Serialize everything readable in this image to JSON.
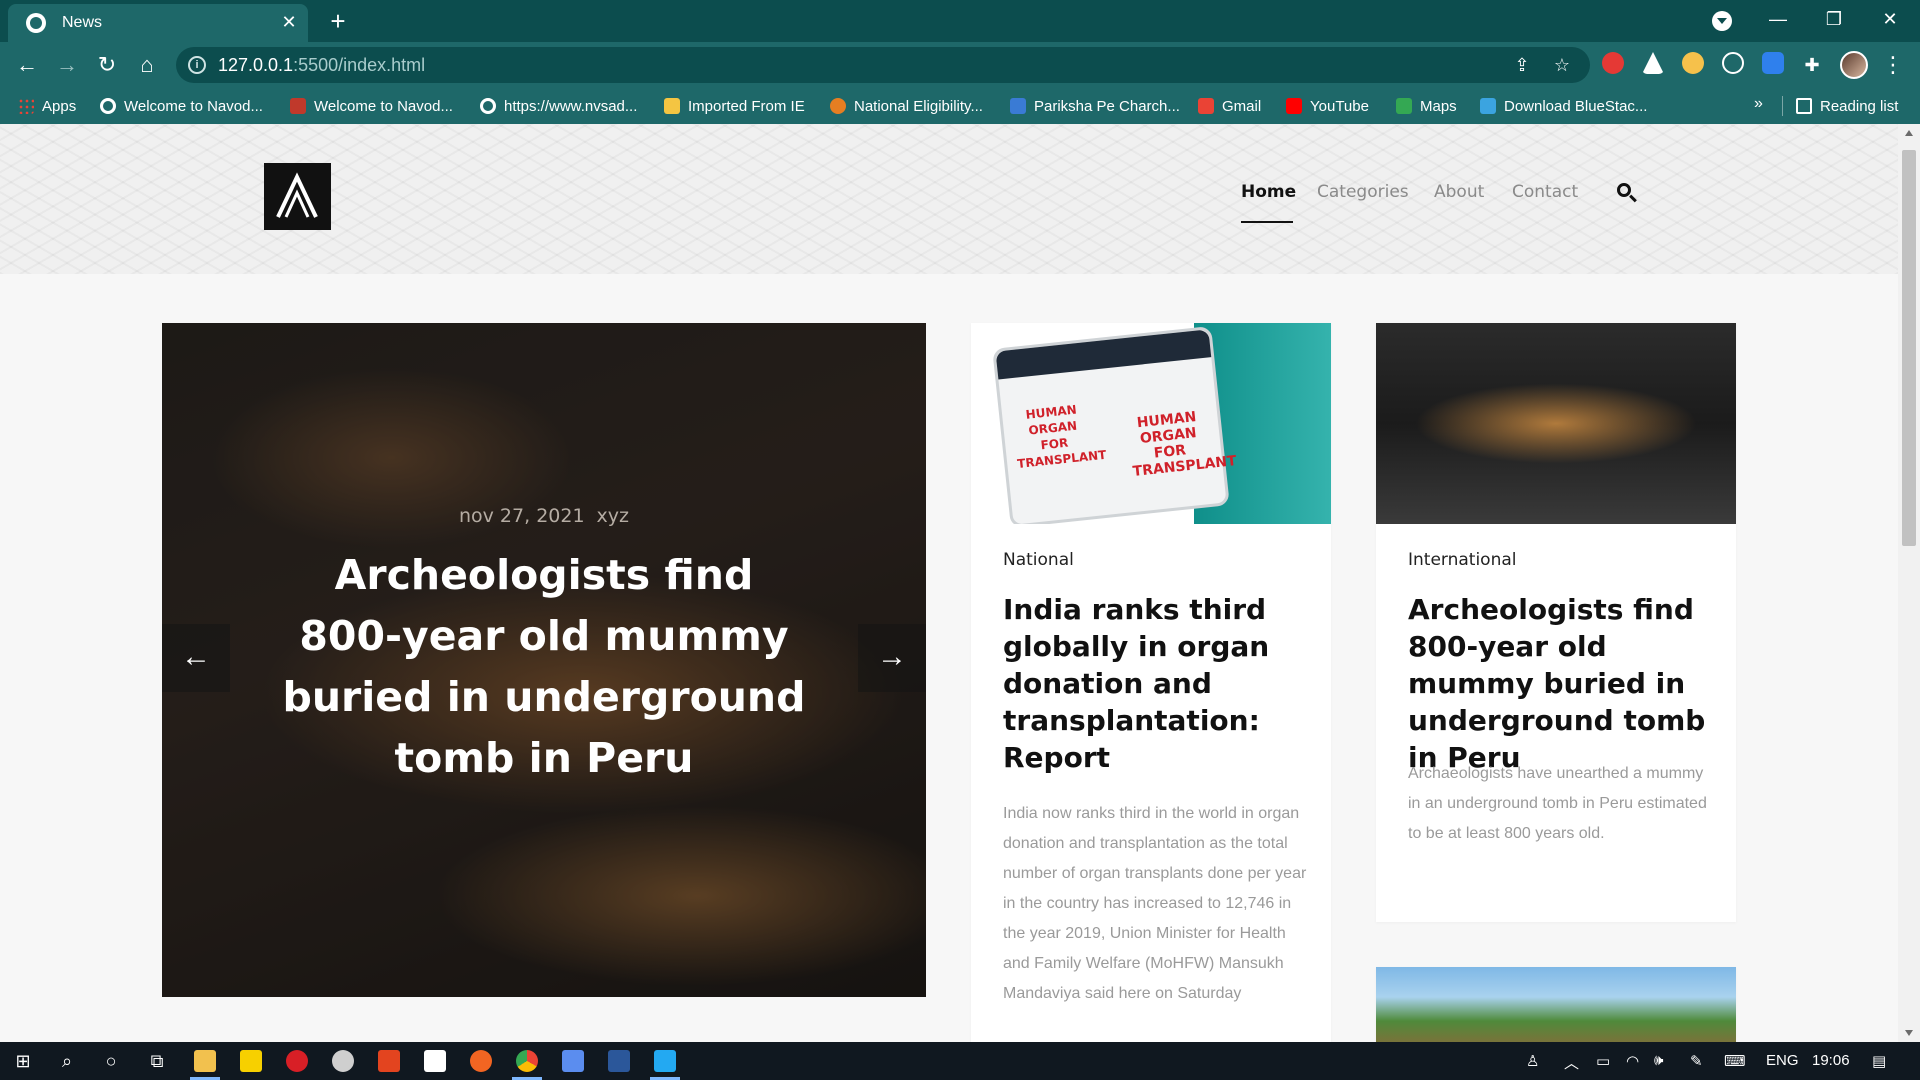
{
  "browser": {
    "tab": {
      "title": "News",
      "close_glyph": "✕",
      "favicon": "globe-icon"
    },
    "new_tab_glyph": "+",
    "window_controls": {
      "minimize": "—",
      "restore": "❐",
      "close": "✕"
    },
    "address": {
      "host": "127.0.0.1",
      "path": ":5500/index.html"
    },
    "nav": {
      "back": "←",
      "forward": "→",
      "reload": "↻",
      "home": "⌂"
    },
    "kebab": "⋮",
    "bookmarks": [
      {
        "label": "Apps",
        "icon": "apps-grid-icon",
        "color": "#ea4335"
      },
      {
        "label": "Welcome to Navod...",
        "icon": "globe-icon",
        "color": "#ffffff"
      },
      {
        "label": "Welcome to Navod...",
        "icon": "site-icon",
        "color": "#c0392b"
      },
      {
        "label": "https://www.nvsad...",
        "icon": "globe-icon",
        "color": "#ffffff"
      },
      {
        "label": "Imported From IE",
        "icon": "folder-icon",
        "color": "#f4c542"
      },
      {
        "label": "National Eligibility...",
        "icon": "emblem-icon",
        "color": "#e67e22"
      },
      {
        "label": "Pariksha Pe Charch...",
        "icon": "site-icon",
        "color": "#3a7bd5"
      },
      {
        "label": "Gmail",
        "icon": "gmail-icon",
        "color": "#ea4335"
      },
      {
        "label": "YouTube",
        "icon": "youtube-icon",
        "color": "#ff0000"
      },
      {
        "label": "Maps",
        "icon": "maps-icon",
        "color": "#34a853"
      },
      {
        "label": "Download BlueStac...",
        "icon": "bluestacks-icon",
        "color": "#3ba4e0"
      }
    ],
    "bookmarks_more": "»",
    "reading_list": "Reading list"
  },
  "site": {
    "menu": {
      "home": "Home",
      "categories": "Categories",
      "about": "About",
      "contact": "Contact"
    }
  },
  "hero": {
    "date": "nov 27, 2021",
    "author": "xyz",
    "title": "Archeologists find 800-year old mummy buried in underground tomb in Peru",
    "prev": "←",
    "next": "→"
  },
  "cards": [
    {
      "category": "National",
      "title": "India ranks third globally in organ donation and transplantation: Report",
      "text": "India now ranks third in the world in organ donation and transplantation as the total number of organ transplants done per year in the country has increased to 12,746 in the year 2019, Union Minister for Health and Family Welfare (MoHFW) Mansukh Mandaviya said here on Saturday",
      "image_label": "HUMAN ORGAN FOR TRANSPLANT"
    },
    {
      "category": "International",
      "title": "Archeologists find 800-year old mummy buried in underground tomb in Peru",
      "text": "Archaeologists have unearthed a mummy in an underground tomb in Peru estimated to be at least 800 years old."
    }
  ],
  "taskbar": {
    "language": "ENG",
    "time": "19:06"
  },
  "colors": {
    "chrome_dark": "#0c4d4e",
    "chrome": "#1e6869",
    "accent": "#111111"
  }
}
